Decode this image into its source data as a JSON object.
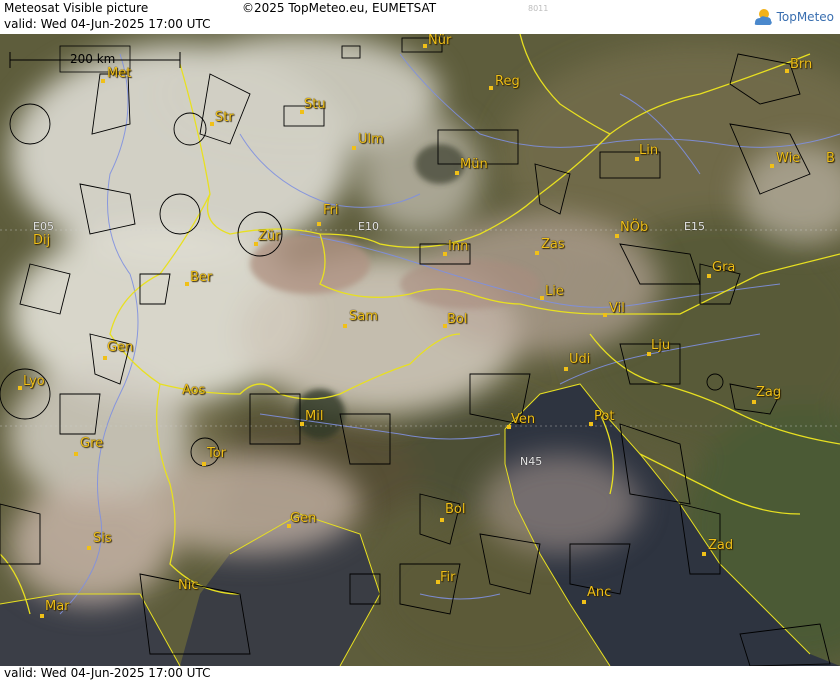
{
  "header": {
    "title": "Meteosat Visible picture",
    "valid": "valid:  Wed  04-Jun-2025  17:00 UTC",
    "copyright": "©2025 TopMeteo.eu, EUMETSAT",
    "frame_id": "8011",
    "logo_text": "TopMeteo",
    "logo_icon": "sun-cloud-logo"
  },
  "footer": {
    "valid": "valid:  Wed  04-Jun-2025  17:00 UTC"
  },
  "scale": {
    "label": "200 km"
  },
  "grid_labels": [
    "E05",
    "E10",
    "E15",
    "N45"
  ],
  "cities": [
    "Nür",
    "Reg",
    "Brn",
    "Met",
    "Str",
    "Stu",
    "Ulm",
    "Mün",
    "Lin",
    "Wie",
    "B",
    "Fri",
    "Dij",
    "Zür",
    "Inn",
    "Zas",
    "NÖb",
    "Gra",
    "Ber",
    "Lie",
    "Sam",
    "Bol",
    "Vil",
    "Gen",
    "Lju",
    "Udi",
    "Lyo",
    "Aos",
    "Zag",
    "Mil",
    "Ven",
    "Pot",
    "Gre",
    "Tor",
    "Gen",
    "Bol",
    "Sis",
    "Zad",
    "Nic",
    "Fir",
    "Anc",
    "Mar"
  ],
  "colors": {
    "borders": "#e8e020",
    "rivers": "#7f90e0",
    "outlines": "#000000",
    "labels": "#f0c018",
    "sea": "#2c3340"
  }
}
